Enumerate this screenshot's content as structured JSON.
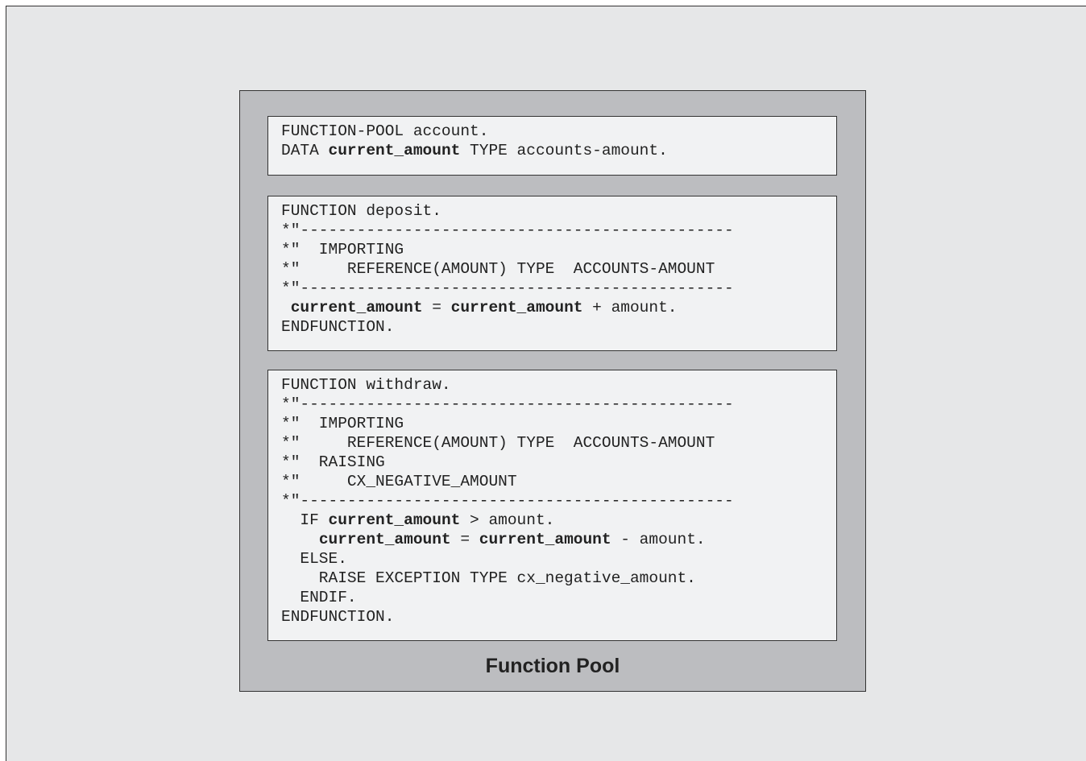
{
  "pool_label": "Function Pool",
  "blocks": [
    {
      "name": "code-block-global-data",
      "lines": [
        [
          [
            "FUNCTION-POOL account.",
            false
          ]
        ],
        [
          [
            "DATA ",
            false
          ],
          [
            "current_amount",
            true
          ],
          [
            " TYPE accounts-amount.",
            false
          ]
        ]
      ]
    },
    {
      "name": "code-block-function-deposit",
      "lines": [
        [
          [
            "FUNCTION deposit.",
            false
          ]
        ],
        [
          [
            "*\"----------------------------------------------",
            false
          ]
        ],
        [
          [
            "*\"  IMPORTING",
            false
          ]
        ],
        [
          [
            "*\"     REFERENCE(AMOUNT) TYPE  ACCOUNTS-AMOUNT",
            false
          ]
        ],
        [
          [
            "*\"----------------------------------------------",
            false
          ]
        ],
        [
          [
            " ",
            false
          ],
          [
            "current_amount",
            true
          ],
          [
            " = ",
            false
          ],
          [
            "current_amount",
            true
          ],
          [
            " + amount.",
            false
          ]
        ],
        [
          [
            "ENDFUNCTION.",
            false
          ]
        ]
      ]
    },
    {
      "name": "code-block-function-withdraw",
      "lines": [
        [
          [
            "FUNCTION withdraw.",
            false
          ]
        ],
        [
          [
            "*\"----------------------------------------------",
            false
          ]
        ],
        [
          [
            "*\"  IMPORTING",
            false
          ]
        ],
        [
          [
            "*\"     REFERENCE(AMOUNT) TYPE  ACCOUNTS-AMOUNT",
            false
          ]
        ],
        [
          [
            "*\"  RAISING",
            false
          ]
        ],
        [
          [
            "*\"     CX_NEGATIVE_AMOUNT",
            false
          ]
        ],
        [
          [
            "*\"----------------------------------------------",
            false
          ]
        ],
        [
          [
            "  IF ",
            false
          ],
          [
            "current_amount",
            true
          ],
          [
            " > amount.",
            false
          ]
        ],
        [
          [
            "    ",
            false
          ],
          [
            "current_amount",
            true
          ],
          [
            " = ",
            false
          ],
          [
            "current_amount",
            true
          ],
          [
            " - amount.",
            false
          ]
        ],
        [
          [
            "  ELSE.",
            false
          ]
        ],
        [
          [
            "    RAISE EXCEPTION TYPE cx_negative_amount.",
            false
          ]
        ],
        [
          [
            "  ENDIF.",
            false
          ]
        ],
        [
          [
            "ENDFUNCTION.",
            false
          ]
        ]
      ]
    }
  ]
}
